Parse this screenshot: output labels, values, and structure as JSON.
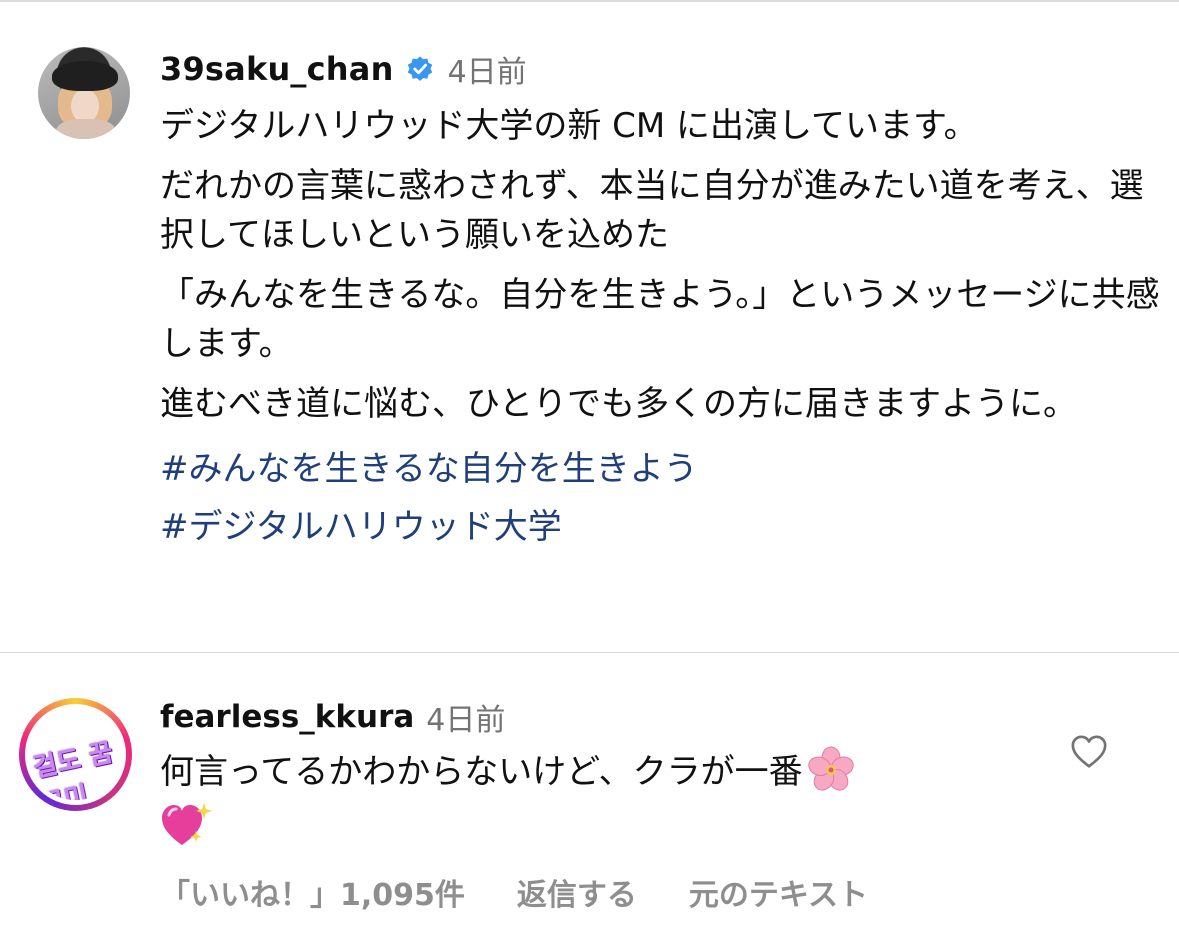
{
  "post": {
    "username": "39saku_chan",
    "verified_icon": "verified-badge-icon",
    "time_ago": "4日前",
    "caption": [
      "デジタルハリウッド大学の新 CM に出演しています。",
      "だれかの言葉に惑わされず、本当に自分が進みたい道を考え、選択してほしいという願いを込めた",
      "「みんなを生きるな。自分を生きよう。」というメッセージに共感します。",
      "進むべき道に悩む、ひとりでも多くの方に届きますように。"
    ],
    "hashtags": [
      "#みんなを生きるな自分を生きよう",
      "#デジタルハリウッド大学"
    ],
    "hashtag_color": "#1f3f7a",
    "verified_color": "#3897f0"
  },
  "comment": {
    "username": "fearless_kkura",
    "time_ago": "4日前",
    "text": "何言ってるかわからないけど、クラが一番",
    "emojis": [
      "cherry-blossom-emoji",
      "sparkling-heart-emoji"
    ],
    "likes_label": "「いいね！」1,095件",
    "reply_label": "返信する",
    "original_text_label": "元のテキスト",
    "avatar_logo_text": "걸도 꿈꾸미",
    "like_icon": "heart-outline-icon"
  }
}
